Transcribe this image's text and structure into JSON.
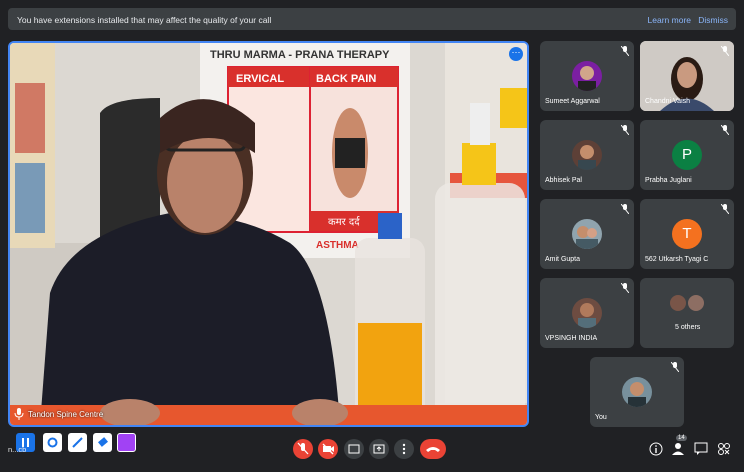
{
  "banner": {
    "message": "You have extensions installed that may affect the quality of your call",
    "learn_more": "Learn more",
    "dismiss": "Dismiss"
  },
  "main_speaker": {
    "label": "Tandon Spine Centre",
    "poster_title": "THRU MARMA - PRANA THERAPY",
    "poster_left": "ERVICAL",
    "poster_right": "BACK PAIN",
    "poster_hindi": "कमर दर्द",
    "poster_bottom": "ASTHMA"
  },
  "participants": [
    {
      "name": "Sumeet Aggarwal",
      "type": "photo",
      "muted": true
    },
    {
      "name": "Chandni Vaish",
      "type": "video",
      "muted": true
    },
    {
      "name": "Abhisek Pal",
      "type": "photo",
      "muted": true
    },
    {
      "name": "Prabha Juglani",
      "type": "letter",
      "letter": "P",
      "color": "#0b8043",
      "muted": true
    },
    {
      "name": "Amit Gupta",
      "type": "photo",
      "muted": true
    },
    {
      "name": "562 Utkarsh Tyagi C",
      "type": "letter",
      "letter": "T",
      "color": "#f4711f",
      "muted": true
    },
    {
      "name": "VPSINGH INDIA",
      "type": "photo",
      "muted": true
    },
    {
      "name": "5 others",
      "type": "group"
    },
    {
      "name": "You",
      "type": "photo",
      "muted": true
    }
  ],
  "toolbar": {
    "user_name_truncated": "n...cb",
    "people_count": "14",
    "colors": {
      "end_call": "#ea4335",
      "mic_off": "#ea4335",
      "accent": "#1a73e8",
      "purple": "#a142f4"
    }
  }
}
